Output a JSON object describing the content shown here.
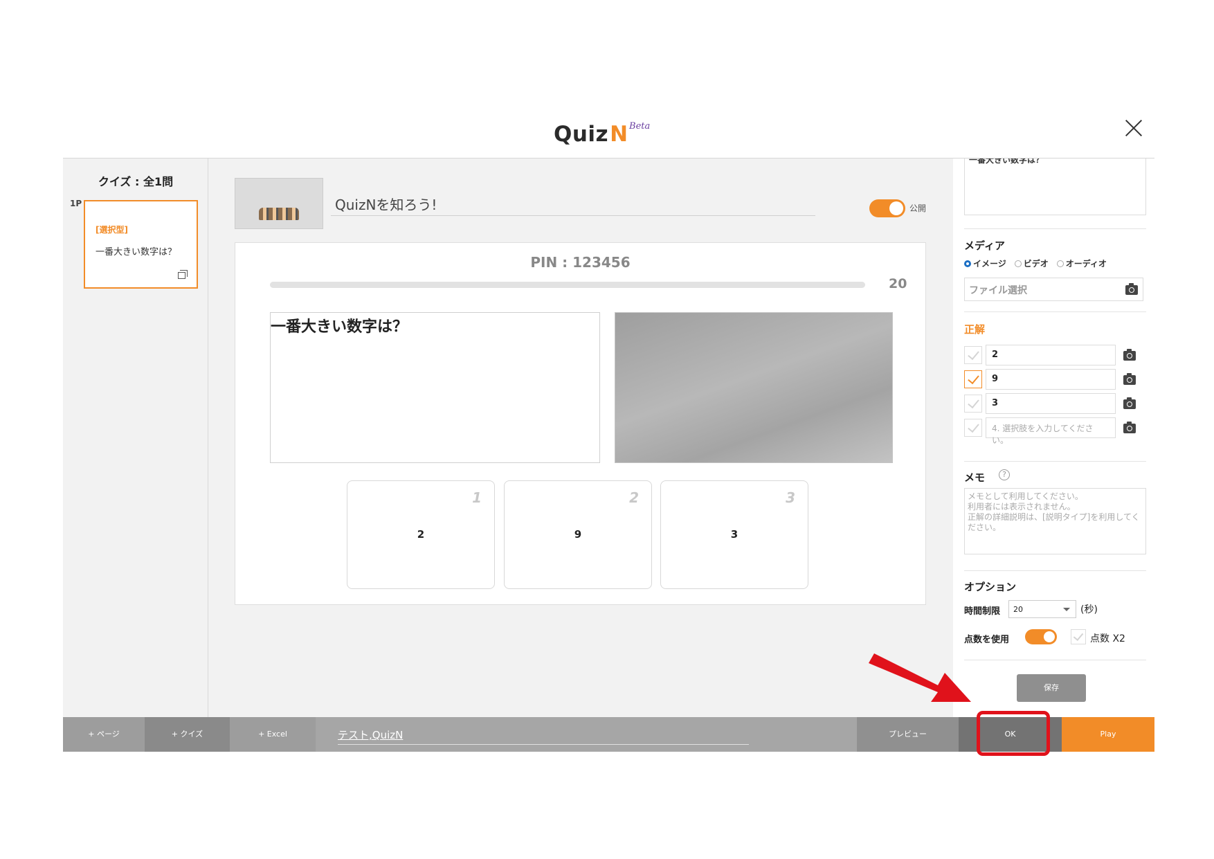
{
  "header": {
    "logo_text": "Quiz",
    "logo_n": "N",
    "logo_beta": "Beta"
  },
  "left_panel": {
    "quiz_count": "クイズ : 全1問",
    "page_label": "1P",
    "card": {
      "type": "[選択型]",
      "question": "一番大きい数字は？"
    }
  },
  "top": {
    "title": "QuizNを知ろう!",
    "publish_label": "公開",
    "publish_on": true
  },
  "preview": {
    "pin": "PIN : 123456",
    "timer": "20",
    "question": "一番大きい数字は？",
    "answers": [
      {
        "num": "1",
        "value": "2"
      },
      {
        "num": "2",
        "value": "9"
      },
      {
        "num": "3",
        "value": "3"
      }
    ]
  },
  "right_panel": {
    "question_text": "一番大きい数字は？",
    "media_title": "メディア",
    "media_options": [
      "イメージ",
      "ビデオ",
      "オーディオ"
    ],
    "media_selected": "イメージ",
    "file_select": "ファイル選択",
    "answer_title": "正解",
    "choices": [
      {
        "value": "2",
        "correct": false
      },
      {
        "value": "9",
        "correct": true
      },
      {
        "value": "3",
        "correct": false
      },
      {
        "value": "",
        "placeholder": "4. 選択肢を入力してください。",
        "correct": false
      }
    ],
    "memo_title": "メモ",
    "memo_placeholder": "メモとして利用してください。\n利用者には表示されません。\n 正解の詳細説明は、[説明タイプ]を利用してください。",
    "option_title": "オプション",
    "time_limit_label": "時間制限",
    "time_limit_value": "20",
    "time_unit": "(秒)",
    "score_label": "点数を使用",
    "score_on": true,
    "x2_label": "点数 X2",
    "save_label": "保存"
  },
  "bottom_bar": {
    "add_page": "+ ページ",
    "add_quiz": "+ クイズ",
    "add_excel": "+ Excel",
    "tags": "テスト,QuizN",
    "preview": "プレビュー",
    "ok": "OK",
    "play": "Play"
  },
  "colors": {
    "accent": "#f28c28",
    "annotation": "#e0121b",
    "bottom_bar": "#a6a6a6"
  }
}
